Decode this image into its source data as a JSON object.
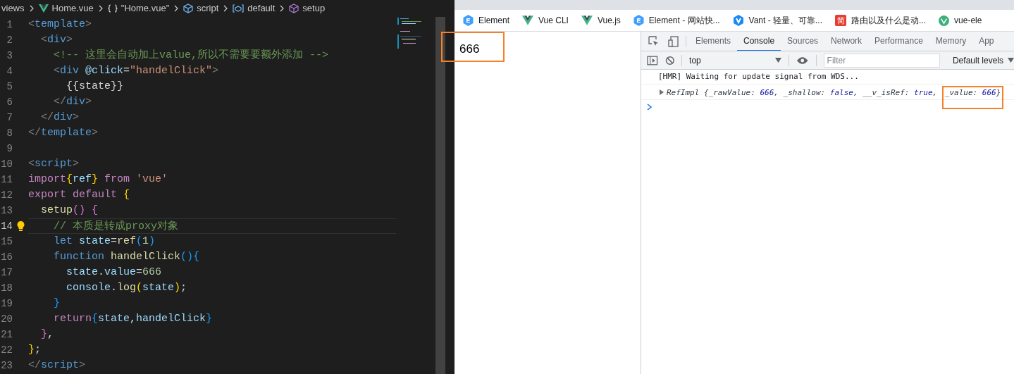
{
  "breadcrumbs": [
    {
      "label": "views",
      "kind": "folder"
    },
    {
      "label": "Home.vue",
      "kind": "vue"
    },
    {
      "label": "\"Home.vue\"",
      "kind": "braces"
    },
    {
      "label": "script",
      "kind": "module"
    },
    {
      "label": "default",
      "kind": "variable"
    },
    {
      "label": "setup",
      "kind": "method"
    }
  ],
  "editor": {
    "lines": [
      {
        "number": "1",
        "current": false,
        "tokens": [
          {
            "text": "<",
            "kind": "punc"
          },
          {
            "text": "template",
            "kind": "tag"
          },
          {
            "text": ">",
            "kind": "punc"
          }
        ]
      },
      {
        "number": "2",
        "current": false,
        "tokens": [
          {
            "text": "  <",
            "kind": "punc"
          },
          {
            "text": "div",
            "kind": "tag"
          },
          {
            "text": ">",
            "kind": "punc"
          }
        ]
      },
      {
        "number": "3",
        "current": false,
        "tokens": [
          {
            "text": "    <!-- 这里会自动加上value,所以不需要要额外添加 -->",
            "kind": "comment"
          }
        ]
      },
      {
        "number": "4",
        "current": false,
        "tokens": [
          {
            "text": "    <",
            "kind": "punc"
          },
          {
            "text": "div",
            "kind": "tag"
          },
          {
            "text": " @click",
            "kind": "attr"
          },
          {
            "text": "=",
            "kind": "text"
          },
          {
            "text": "\"handelClick\"",
            "kind": "string"
          },
          {
            "text": ">",
            "kind": "punc"
          }
        ]
      },
      {
        "number": "5",
        "current": false,
        "tokens": [
          {
            "text": "      {{state}}",
            "kind": "text"
          }
        ]
      },
      {
        "number": "6",
        "current": false,
        "tokens": [
          {
            "text": "    </",
            "kind": "punc"
          },
          {
            "text": "div",
            "kind": "tag"
          },
          {
            "text": ">",
            "kind": "punc"
          }
        ]
      },
      {
        "number": "7",
        "current": false,
        "tokens": [
          {
            "text": "  </",
            "kind": "punc"
          },
          {
            "text": "div",
            "kind": "tag"
          },
          {
            "text": ">",
            "kind": "punc"
          }
        ]
      },
      {
        "number": "8",
        "current": false,
        "tokens": [
          {
            "text": "</",
            "kind": "punc"
          },
          {
            "text": "template",
            "kind": "tag"
          },
          {
            "text": ">",
            "kind": "punc"
          }
        ]
      },
      {
        "number": "9",
        "current": false
      },
      {
        "number": "10",
        "current": false,
        "tokens": [
          {
            "text": "<",
            "kind": "punc"
          },
          {
            "text": "script",
            "kind": "tag"
          },
          {
            "text": ">",
            "kind": "punc"
          }
        ]
      },
      {
        "number": "11",
        "current": false,
        "tokens": [
          {
            "text": "import",
            "kind": "keyword"
          },
          {
            "text": "{",
            "kind": "brace1"
          },
          {
            "text": "ref",
            "kind": "var"
          },
          {
            "text": "}",
            "kind": "brace1"
          },
          {
            "text": " from ",
            "kind": "keyword"
          },
          {
            "text": "'vue'",
            "kind": "string"
          }
        ]
      },
      {
        "number": "12",
        "current": false,
        "tokens": [
          {
            "text": "export default ",
            "kind": "keyword"
          },
          {
            "text": "{",
            "kind": "brace1"
          }
        ]
      },
      {
        "number": "13",
        "current": false,
        "tokens": [
          {
            "text": "  setup",
            "kind": "func"
          },
          {
            "text": "()",
            "kind": "brace2"
          },
          {
            "text": " {",
            "kind": "brace2"
          }
        ]
      },
      {
        "number": "14",
        "current": true,
        "tokens": [
          {
            "text": "    // 本质是转成proxy对象",
            "kind": "comment"
          }
        ]
      },
      {
        "number": "15",
        "current": false,
        "tokens": [
          {
            "text": "    let ",
            "kind": "storage"
          },
          {
            "text": "state",
            "kind": "var"
          },
          {
            "text": "=",
            "kind": "text"
          },
          {
            "text": "ref",
            "kind": "func"
          },
          {
            "text": "(",
            "kind": "brace3"
          },
          {
            "text": "1",
            "kind": "num"
          },
          {
            "text": ")",
            "kind": "brace3"
          }
        ]
      },
      {
        "number": "16",
        "current": false,
        "tokens": [
          {
            "text": "    function ",
            "kind": "storage"
          },
          {
            "text": "handelClick",
            "kind": "func"
          },
          {
            "text": "(){",
            "kind": "brace3"
          }
        ]
      },
      {
        "number": "17",
        "current": false,
        "tokens": [
          {
            "text": "      state",
            "kind": "var"
          },
          {
            "text": ".",
            "kind": "text"
          },
          {
            "text": "value",
            "kind": "var"
          },
          {
            "text": "=",
            "kind": "text"
          },
          {
            "text": "666",
            "kind": "num"
          }
        ]
      },
      {
        "number": "18",
        "current": false,
        "tokens": [
          {
            "text": "      console",
            "kind": "var"
          },
          {
            "text": ".",
            "kind": "text"
          },
          {
            "text": "log",
            "kind": "func"
          },
          {
            "text": "(",
            "kind": "brace1"
          },
          {
            "text": "state",
            "kind": "var"
          },
          {
            "text": ")",
            "kind": "brace1"
          },
          {
            "text": ";",
            "kind": "text"
          }
        ]
      },
      {
        "number": "19",
        "current": false,
        "tokens": [
          {
            "text": "    }",
            "kind": "brace3"
          }
        ]
      },
      {
        "number": "20",
        "current": false,
        "tokens": [
          {
            "text": "    return",
            "kind": "keyword"
          },
          {
            "text": "{",
            "kind": "brace3"
          },
          {
            "text": "state",
            "kind": "var"
          },
          {
            "text": ",",
            "kind": "text"
          },
          {
            "text": "handelClick",
            "kind": "var"
          },
          {
            "text": "}",
            "kind": "brace3"
          }
        ]
      },
      {
        "number": "21",
        "current": false,
        "tokens": [
          {
            "text": "  }",
            "kind": "brace2"
          },
          {
            "text": ",",
            "kind": "text"
          }
        ]
      },
      {
        "number": "22",
        "current": false,
        "tokens": [
          {
            "text": "}",
            "kind": "brace1"
          },
          {
            "text": ";",
            "kind": "text"
          }
        ]
      },
      {
        "number": "23",
        "current": false,
        "tokens": [
          {
            "text": "</",
            "kind": "punc"
          },
          {
            "text": "script",
            "kind": "tag"
          },
          {
            "text": ">",
            "kind": "punc"
          }
        ]
      }
    ]
  },
  "bookmarks": [
    {
      "label": "Element",
      "kind": "element"
    },
    {
      "label": "Vue CLI",
      "kind": "vue"
    },
    {
      "label": "Vue.js",
      "kind": "vue"
    },
    {
      "label": "Element - 网站快...",
      "kind": "element"
    },
    {
      "label": "Vant - 轻量、可靠...",
      "kind": "vant"
    },
    {
      "label": "路由以及什么是动...",
      "kind": "letter",
      "icon_text": "简"
    },
    {
      "label": "vue-ele",
      "kind": "vue-round"
    }
  ],
  "page": {
    "text": "666",
    "highlighted": true
  },
  "devtools": {
    "tabs": [
      {
        "label": "Elements",
        "selected": false
      },
      {
        "label": "Console",
        "selected": true
      },
      {
        "label": "Sources",
        "selected": false
      },
      {
        "label": "Network",
        "selected": false
      },
      {
        "label": "Performance",
        "selected": false
      },
      {
        "label": "Memory",
        "selected": false
      },
      {
        "label": "App",
        "selected": false
      }
    ],
    "context": "top",
    "filter": {
      "placeholder": "Filter"
    },
    "levels": "Default levels",
    "messages": [
      {
        "kind": "log",
        "text": "[HMR] Waiting for update signal from WDS..."
      },
      {
        "kind": "object",
        "parts": [
          {
            "text": "RefImpl {_rawValue: ",
            "kind": "plain"
          },
          {
            "text": "666",
            "kind": "value"
          },
          {
            "text": ", _shallow: ",
            "kind": "plain"
          },
          {
            "text": "false",
            "kind": "value"
          },
          {
            "text": ", __v_isRef: ",
            "kind": "plain"
          },
          {
            "text": "true",
            "kind": "value"
          },
          {
            "text": ", ",
            "kind": "plain"
          },
          {
            "text": "_value: ",
            "kind": "plain",
            "highlighted": true
          },
          {
            "text": "666",
            "kind": "value",
            "highlighted": true
          },
          {
            "text": "}",
            "kind": "plain",
            "highlighted": true
          }
        ]
      }
    ]
  }
}
